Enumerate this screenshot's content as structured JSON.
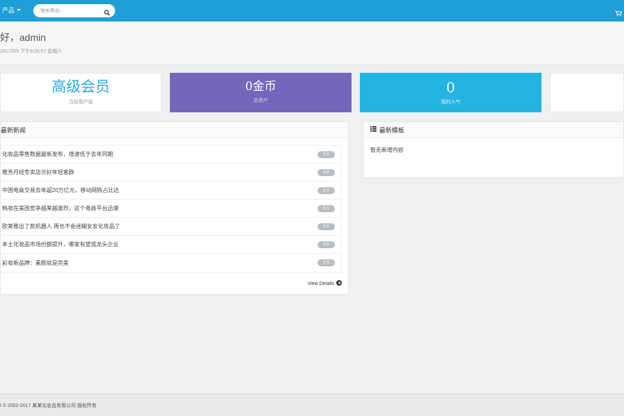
{
  "topbar": {
    "menu_label": "产品",
    "search_placeholder": "搜索商品..."
  },
  "greeting": {
    "text": "好，admin",
    "datetime": "2017/6/5 下午6:06:57 星期六"
  },
  "stats": [
    {
      "value": "高级会员",
      "label": "当前用户组"
    },
    {
      "value": "0金币",
      "label": "总资产"
    },
    {
      "value": "0",
      "label": "我的人气"
    }
  ],
  "news": {
    "title": "最新新闻",
    "items": [
      {
        "title": "化妆品零售数据最新发布，增速低于去年同期",
        "date": "6.5"
      },
      {
        "title": "雅芳月结专卖店示好年轻客群",
        "date": "6.5"
      },
      {
        "title": "中国电商交易去年超20万亿元，移动网购占比达",
        "date": "6.5"
      },
      {
        "title": "韩妆在美国竞争越来越激烈，这个电商平台迅速",
        "date": "6.5"
      },
      {
        "title": "欧莱雅出了款机器人 再也不会迷糊女友化妆品了",
        "date": "6.5"
      },
      {
        "title": "本土化妆品市场份额提升，哪家有望成龙头企业",
        "date": "6.5"
      },
      {
        "title": "彩妆新品牌：素颜就是完美",
        "date": "6.5"
      }
    ],
    "view_details": "View Details"
  },
  "templates": {
    "title": "最新模板",
    "empty_text": "暂无新增内容"
  },
  "footer": {
    "text": "t © 2002-2017 某某化妆品有限公司 版权所有"
  }
}
